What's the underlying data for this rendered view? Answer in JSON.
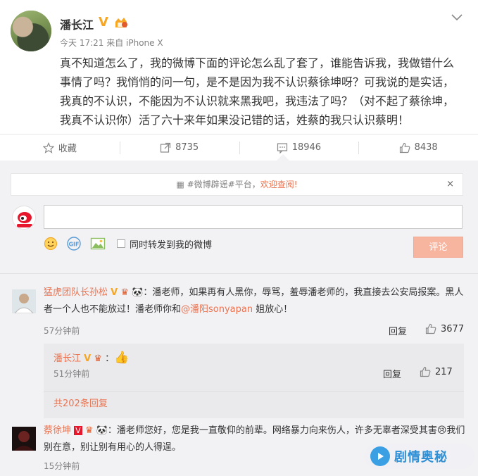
{
  "post": {
    "author": "潘长江",
    "meta": "今天 17:21 来自 iPhone X",
    "text": "真不知道怎么了，我的微博下面的评论怎么乱了套了，谁能告诉我，我做错什么事情了吗？我悄悄的问一句，是不是因为我不认识蔡徐坤呀？可我说的是实话，我真的不认识，不能因为不认识就来黑我吧，我违法了吗？（对不起了蔡徐坤，我真不认识你）活了六十来年如果没记错的话，姓蔡的我只认识蔡明！",
    "verified_badge": "V"
  },
  "actions": {
    "favorite_label": "收藏",
    "repost_count": "8735",
    "comment_count": "18946",
    "like_count": "8438"
  },
  "notice": {
    "prefix": "#微博辟谣#平台，",
    "highlight": "欢迎查阅!",
    "close": "×"
  },
  "composer": {
    "placeholder": "",
    "also_repost_label": "同时转发到我的微博",
    "submit_label": "评论"
  },
  "comments": [
    {
      "author": "猛虎团队长孙松",
      "text_1": "：潘老师，如果再有人黑你，辱骂，羞辱潘老师的，我直接去公安局报案。黑人者一个人也不能放过！潘老师你和",
      "mention": "@潘阳sonyapan",
      "text_2": " 姐放心！",
      "time": "57分钟前",
      "reply_label": "回复",
      "likes": "3677",
      "sub_reply": {
        "author": "潘长江",
        "emoji": "👍",
        "time": "51分钟前",
        "reply_label": "回复",
        "likes": "217"
      },
      "more_replies": "共202条回复"
    },
    {
      "author": "蔡徐坤",
      "text_1": "：潘老师您好，您是我一直敬仰的前辈。网络暴力向来伤人，许多无辜者深受其害",
      "text_2": "我们别在意，别让别有用心的人得逞。",
      "time": "15分钟前"
    }
  ],
  "watermark": {
    "text": "剧情奥秘"
  },
  "colors": {
    "accent": "#eb7350",
    "badge_orange": "#f6a623",
    "submit_disabled": "#f7b49f",
    "panel_bg": "#f2f2f5"
  }
}
